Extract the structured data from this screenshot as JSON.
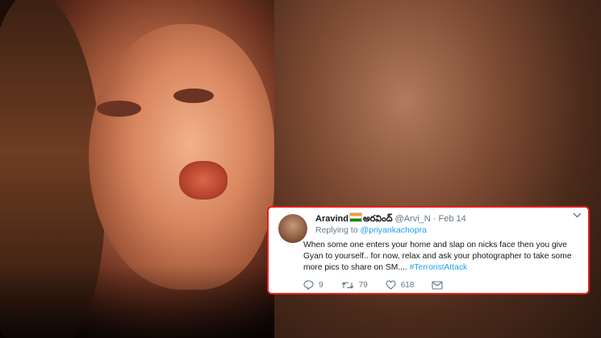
{
  "tweet": {
    "display_name": "Aravind",
    "display_name_telugu": "అరవింద్",
    "handle": "@Arvi_N",
    "separator": "·",
    "date": "Feb 14",
    "replying_prefix": "Replying to",
    "replying_to": "@priyankachopra",
    "body": "When some one enters your home and slap on nicks face then you give Gyan to yourself.. for now, relax and ask your photographer to take some more pics to share on SM.... ",
    "hashtag": "#TerroristAttack",
    "replies": "9",
    "retweets": "79",
    "likes": "618"
  },
  "icons": [
    "flag-india-icon",
    "chevron-down-icon",
    "reply-icon",
    "retweet-icon",
    "like-icon",
    "message-icon"
  ],
  "colors": {
    "border_red": "#e0201f",
    "link_blue": "#1da1f2",
    "muted": "#657786"
  }
}
